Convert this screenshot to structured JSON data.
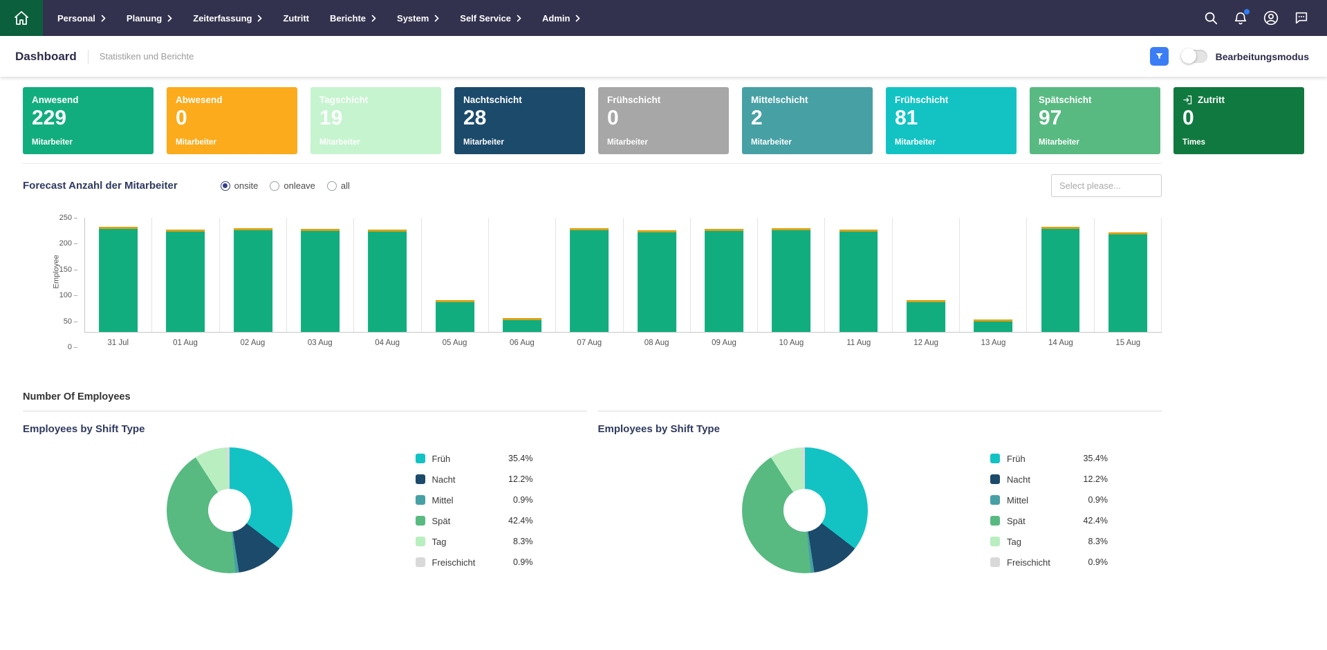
{
  "navbar": {
    "items": [
      {
        "label": "Personal",
        "chevron": true
      },
      {
        "label": "Planung",
        "chevron": true
      },
      {
        "label": "Zeiterfassung",
        "chevron": true
      },
      {
        "label": "Zutritt",
        "chevron": false
      },
      {
        "label": "Berichte",
        "chevron": true
      },
      {
        "label": "System",
        "chevron": true
      },
      {
        "label": "Self Service",
        "chevron": true
      },
      {
        "label": "Admin",
        "chevron": true
      }
    ],
    "icons": [
      "search-icon",
      "notifications-icon",
      "account-icon",
      "chat-icon"
    ],
    "notification_badge_color": "#2e7cf6",
    "background_color": "#32324e",
    "home_button_color": "#0c5f3d"
  },
  "subheader": {
    "title": "Dashboard",
    "breadcrumb": "Statistiken und Berichte",
    "edit_mode_label": "Bearbeitungsmodus",
    "edit_mode_on": false,
    "filter_button_color": "#3b7df5"
  },
  "kpi_cards": [
    {
      "label": "Anwesend",
      "value": "229",
      "unit": "Mitarbeiter",
      "bg": "#12ad7e"
    },
    {
      "label": "Abwesend",
      "value": "0",
      "unit": "Mitarbeiter",
      "bg": "#fbab1c"
    },
    {
      "label": "Tagschicht",
      "value": "19",
      "unit": "Mitarbeiter",
      "bg": "#c6f4cf"
    },
    {
      "label": "Nachtschicht",
      "value": "28",
      "unit": "Mitarbeiter",
      "bg": "#1b4a6b"
    },
    {
      "label": "Frühschicht",
      "value": "0",
      "unit": "Mitarbeiter",
      "bg": "#a7a7a7"
    },
    {
      "label": "Mittelschicht",
      "value": "2",
      "unit": "Mitarbeiter",
      "bg": "#47a0a4"
    },
    {
      "label": "Frühschicht",
      "value": "81",
      "unit": "Mitarbeiter",
      "bg": "#13c3c4"
    },
    {
      "label": "Spätschicht",
      "value": "97",
      "unit": "Mitarbeiter",
      "bg": "#58ba81"
    },
    {
      "label": "Zutritt",
      "value": "0",
      "unit": "Times",
      "bg": "#10793f",
      "icon": "zutritt-icon"
    }
  ],
  "forecast": {
    "title": "Forecast Anzahl der Mitarbeiter",
    "options": [
      {
        "label": "onsite",
        "selected": true
      },
      {
        "label": "onleave",
        "selected": false
      },
      {
        "label": "all",
        "selected": false
      }
    ],
    "select_placeholder": "Select please..."
  },
  "employees_heading": "Number Of Employees",
  "chart_data": [
    {
      "type": "bar",
      "title": "Forecast Anzahl der Mitarbeiter",
      "categories": [
        "31 Jul",
        "01 Aug",
        "02 Aug",
        "03 Aug",
        "04 Aug",
        "05 Aug",
        "06 Aug",
        "07 Aug",
        "08 Aug",
        "09 Aug",
        "10 Aug",
        "11 Aug",
        "12 Aug",
        "13 Aug",
        "14 Aug",
        "15 Aug"
      ],
      "values": [
        230,
        225,
        228,
        226,
        224,
        70,
        30,
        228,
        222,
        226,
        228,
        224,
        70,
        28,
        230,
        218
      ],
      "xlabel": "",
      "ylabel": "Employee",
      "ylim": [
        0,
        250
      ],
      "yticks": [
        0,
        50,
        100,
        150,
        200,
        250
      ],
      "bar_color": "#12ad7e",
      "bar_cap_color": "#dba215",
      "grid": "vertical",
      "legend_position": "none"
    },
    {
      "type": "pie",
      "donut": true,
      "title": "Employees by Shift Type",
      "labels": [
        "Früh",
        "Nacht",
        "Mittel",
        "Spät",
        "Tag",
        "Freischicht"
      ],
      "values": [
        35.4,
        12.2,
        0.9,
        42.4,
        8.3,
        0.9
      ],
      "colors": [
        "#13c3c4",
        "#1b4a6b",
        "#47a0a4",
        "#58ba81",
        "#b9eec0",
        "#d9d9d9"
      ],
      "legend_position": "right"
    },
    {
      "type": "pie",
      "donut": true,
      "title": "Employees by Shift Type",
      "labels": [
        "Früh",
        "Nacht",
        "Mittel",
        "Spät",
        "Tag",
        "Freischicht"
      ],
      "values": [
        35.4,
        12.2,
        0.9,
        42.4,
        8.3,
        0.9
      ],
      "colors": [
        "#13c3c4",
        "#1b4a6b",
        "#47a0a4",
        "#58ba81",
        "#b9eec0",
        "#d9d9d9"
      ],
      "legend_position": "right"
    }
  ]
}
